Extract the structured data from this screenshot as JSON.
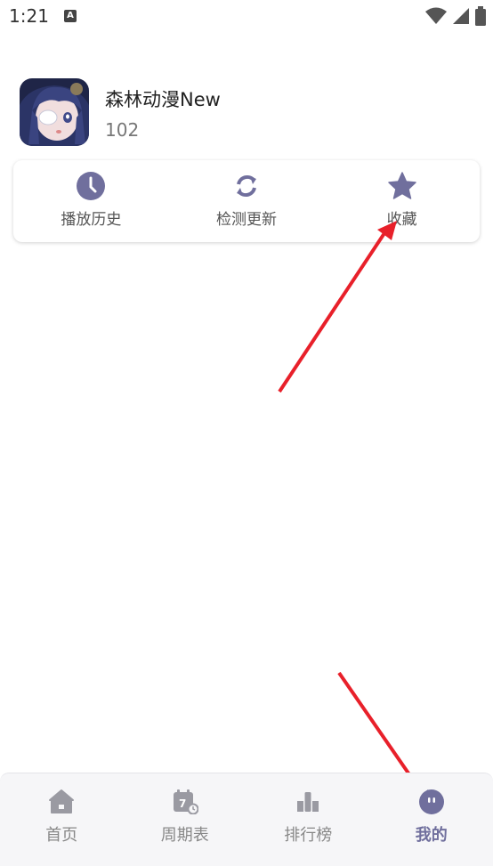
{
  "status_bar": {
    "time": "1:21",
    "notification_icon": "a-icon",
    "wifi_icon": "wifi-icon",
    "signal_icon": "signal-icon",
    "battery_icon": "battery-icon"
  },
  "profile": {
    "app_name": "森林动漫New",
    "version": "102",
    "avatar_icon": "anime-avatar-icon"
  },
  "quick_actions": [
    {
      "label": "播放历史",
      "icon": "clock-icon"
    },
    {
      "label": "检测更新",
      "icon": "refresh-icon"
    },
    {
      "label": "收藏",
      "icon": "star-icon"
    }
  ],
  "bottom_nav": [
    {
      "label": "首页",
      "icon": "home-icon",
      "active": false
    },
    {
      "label": "周期表",
      "icon": "calendar-icon",
      "active": false
    },
    {
      "label": "排行榜",
      "icon": "ranking-icon",
      "active": false
    },
    {
      "label": "我的",
      "icon": "profile-face-icon",
      "active": true
    }
  ],
  "colors": {
    "accent": "#706f9d",
    "inactive": "#9a9aa2",
    "annotation_arrow": "#e8202a"
  }
}
